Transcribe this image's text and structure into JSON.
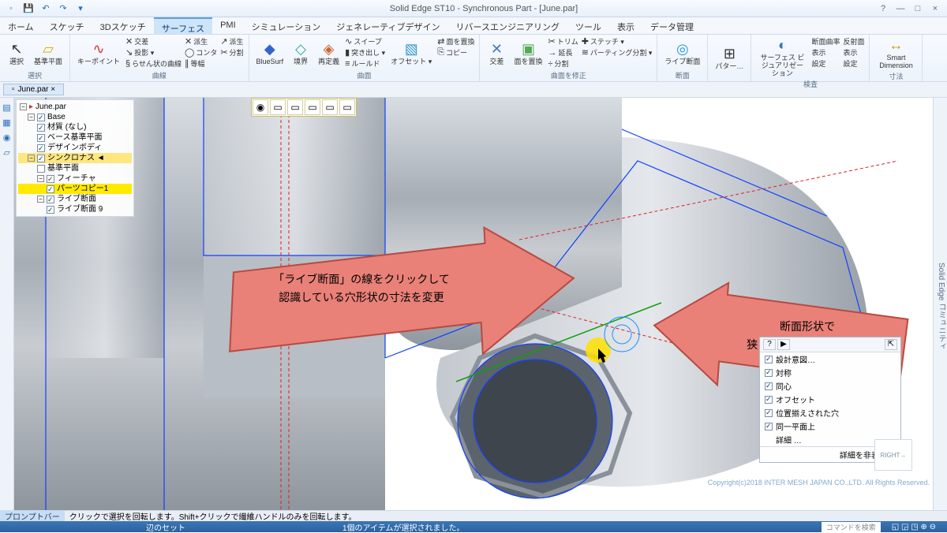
{
  "app": {
    "title": "Solid Edge ST10 - Synchronous Part - [June.par]"
  },
  "window_buttons": {
    "min": "—",
    "max": "□",
    "close": "×",
    "help": "?"
  },
  "tabs": [
    "ホーム",
    "スケッチ",
    "3Dスケッチ",
    "サーフェス",
    "PMI",
    "シミュレーション",
    "ジェネレーティブデザイン",
    "リバースエンジニアリング",
    "ツール",
    "表示",
    "データ管理"
  ],
  "active_tab_index": 3,
  "ribbon": {
    "select_group": {
      "btn": "選択",
      "sub": "基準平面",
      "label": "選択"
    },
    "keypoint_group": {
      "btn": "キーポイント",
      "rows": [
        "交差",
        "投影 ▾",
        "らせん状の曲線"
      ],
      "side": [
        "派生",
        "コンタ",
        "等幅",
        "分割"
      ],
      "label": "曲線"
    },
    "bluesurf_group": {
      "btn": "BlueSurf",
      "b2": "境界",
      "b3": "再定義",
      "label": "曲面",
      "rows": [
        "スイープ",
        "突き出し ▾",
        "ルールド"
      ]
    },
    "offset_group": {
      "btn": "オフセット ▾",
      "rows": [
        "面を置換",
        "コピー",
        ""
      ],
      "label": ""
    },
    "exchange_group": {
      "btn": "交差",
      "b2": "面を置換",
      "label": "曲面を修正",
      "rows": [
        "トリム",
        "延長",
        "分割"
      ],
      "side": [
        "ステッチ ▾",
        "パーティング分割 ▾",
        ""
      ]
    },
    "live_group": {
      "btn": "ライブ断面",
      "label": "断面"
    },
    "pattern_group": {
      "btn": "パター…",
      "label": ""
    },
    "viz_group": {
      "btn": "サーフェス\nビジュアリゼーション",
      "label": "",
      "grid": [
        "断面曲率",
        "反射面",
        "表示",
        "表示",
        "設定",
        "設定"
      ],
      "glabel": "検査"
    },
    "dim_group": {
      "btn": "Smart\nDimension",
      "label": "寸法"
    }
  },
  "doc_tab": "June.par ×",
  "tree": {
    "root": "June.par",
    "items": [
      {
        "lvl": 1,
        "chk": true,
        "txt": "Base"
      },
      {
        "lvl": 2,
        "chk": true,
        "txt": "材質 (なし)"
      },
      {
        "lvl": 2,
        "chk": true,
        "txt": "ベース基準平面"
      },
      {
        "lvl": 2,
        "chk": true,
        "txt": "デザインボディ"
      },
      {
        "lvl": 1,
        "chk": true,
        "txt": "シンクロナス ◄",
        "hl": true
      },
      {
        "lvl": 2,
        "chk": false,
        "txt": "基準平面"
      },
      {
        "lvl": 2,
        "chk": true,
        "txt": "フィーチャ"
      },
      {
        "lvl": 3,
        "chk": true,
        "txt": "パーツコピー1",
        "sel": true
      },
      {
        "lvl": 2,
        "chk": true,
        "txt": "ライブ断面"
      },
      {
        "lvl": 3,
        "chk": true,
        "txt": "ライブ断面 9"
      }
    ]
  },
  "minitool": [
    "◉",
    "▭",
    "▭",
    "▭",
    "▭",
    "▭"
  ],
  "callout_left": {
    "l1": "「ライブ断面」の線をクリックして",
    "l2": "認識している穴形状の寸法を変更"
  },
  "callout_right": {
    "l1": "断面形状で",
    "l2": "狭いクリアランスを確認"
  },
  "relations": {
    "title_btns": [
      "?",
      "▶"
    ],
    "pin": "⇱",
    "header": "設計意図…",
    "items": [
      {
        "chk": true,
        "txt": "対称"
      },
      {
        "chk": true,
        "txt": "同心"
      },
      {
        "chk": true,
        "txt": "オフセット"
      },
      {
        "chk": true,
        "txt": "位置揃えされた穴"
      },
      {
        "chk": true,
        "txt": "同一平面上"
      }
    ],
    "more": "詳細 …",
    "footer": "詳細を非表示 ⌃"
  },
  "cube": "RIGHT→",
  "prompt": {
    "label": "プロンプトバー",
    "msg": "クリックで選択を回転します。Shift+クリックで繊維ハンドルのみを回転します。"
  },
  "status": {
    "left": "辺のセット",
    "mid": "1個のアイテムが選択されました。",
    "search": "コマンドを検索"
  },
  "copyright": "Copyright(c)2018 INTER MESH JAPAN CO.,LTD. All Rights Reserved.",
  "right_panel": "Solid Edge コミュニティ"
}
